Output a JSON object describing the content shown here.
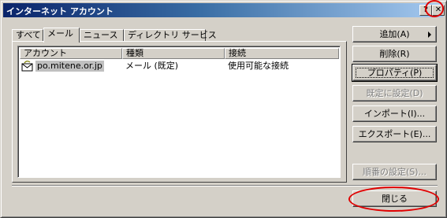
{
  "window": {
    "title": "インターネット アカウント",
    "help_glyph": "?",
    "close_glyph": "✕"
  },
  "tabs": [
    {
      "label": "すべて"
    },
    {
      "label": "メール"
    },
    {
      "label": "ニュース"
    },
    {
      "label": "ディレクトリ サービス"
    }
  ],
  "list": {
    "columns": [
      "アカウント",
      "種類",
      "接続"
    ],
    "rows": [
      {
        "account": "po.mitene.or.jp",
        "type": "メール (既定)",
        "connection": "使用可能な接続"
      }
    ]
  },
  "buttons": {
    "add": "追加(A)",
    "delete": "削除(R)",
    "properties": "プロパティ(P)",
    "set_default": "既定に設定(D)",
    "import": "インポート(I)...",
    "export": "エクスポート(E)...",
    "set_order": "順番の設定(S)...",
    "close": "閉じる"
  },
  "colors": {
    "titlebar_start": "#0a246a",
    "annotation_red": "#e00000",
    "dialog_face": "#d4d0c8"
  },
  "icons": {
    "account_icon": "mail-account-icon",
    "submenu_arrow": "right-arrow-icon"
  }
}
